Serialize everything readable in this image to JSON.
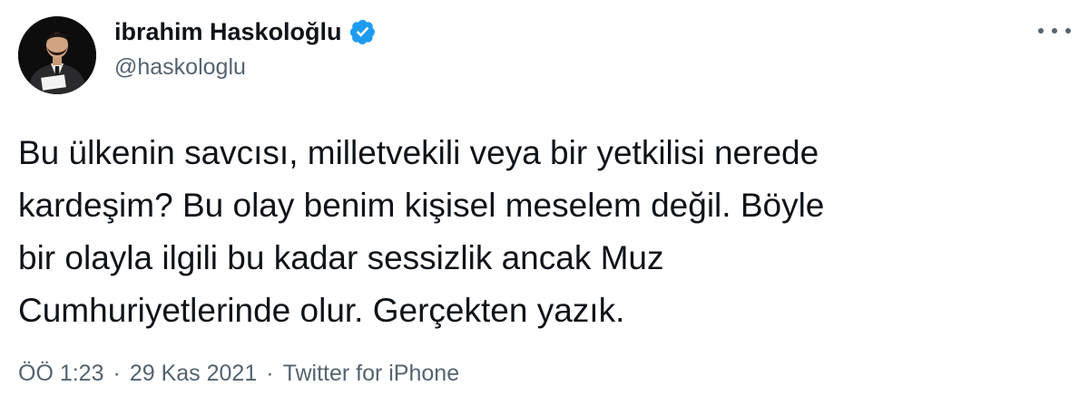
{
  "author": {
    "display_name": "ibrahim Haskoloğlu",
    "handle": "@haskologlu",
    "verified": true,
    "verified_color": "#1d9bf0"
  },
  "tweet": {
    "text": "Bu ülkenin savcısı, milletvekili veya bir yetkilisi nerede\nkardeşim? Bu olay benim kişisel meselem değil. Böyle\nbir olayla ilgili bu kadar sessizlik ancak Muz\nCumhuriyetlerinde olur. Gerçekten yazık."
  },
  "meta": {
    "time": "ÖÖ 1:23",
    "separator": "·",
    "date": "29 Kas 2021",
    "source": "Twitter for iPhone"
  },
  "icons": {
    "avatar": "profile-photo",
    "verified": "verified-badge-icon",
    "more": "more-options-icon"
  },
  "colors": {
    "text_primary": "#0f1419",
    "text_secondary": "#536471",
    "background": "#ffffff"
  }
}
